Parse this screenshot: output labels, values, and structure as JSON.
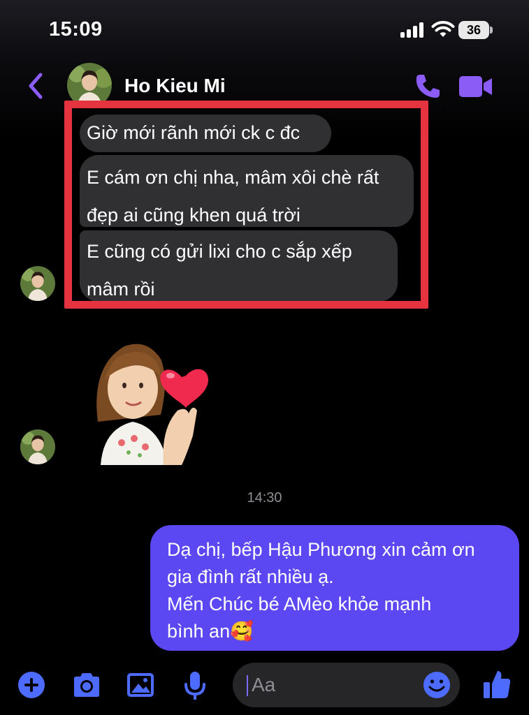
{
  "status_bar": {
    "time": "15:09",
    "battery": "36"
  },
  "header": {
    "contact_name": "Ho Kieu Mi",
    "accent_color": "#8b5cf6"
  },
  "messages": {
    "incoming": [
      {
        "lines": [
          "Giờ mới rãnh mới ck c đc"
        ]
      },
      {
        "lines": [
          "E cám ơn chị nha, mâm xôi chè rất",
          "đẹp ai cũng khen quá trời"
        ]
      },
      {
        "lines": [
          "E cũng có gửi lixi cho c sắp xếp",
          "mâm rồi"
        ]
      }
    ],
    "sticker": "heart-finger-sticker",
    "timestamp": "14:30",
    "outgoing": {
      "lines": [
        "Dạ chị, bếp Hậu Phương xin cảm ơn",
        "gia đình rất nhiều ạ.",
        "Mến Chúc bé AMèo khỏe mạnh",
        "bình an🥰"
      ],
      "bubble_color": "#5b48f3"
    }
  },
  "composer": {
    "placeholder": "Aa",
    "icons": [
      "plus-icon",
      "camera-icon",
      "image-icon",
      "microphone-icon",
      "emoji-icon",
      "thumbs-up-icon"
    ],
    "icon_color": "#4d6bff"
  },
  "annotation": {
    "highlight_color": "#e5343f"
  }
}
